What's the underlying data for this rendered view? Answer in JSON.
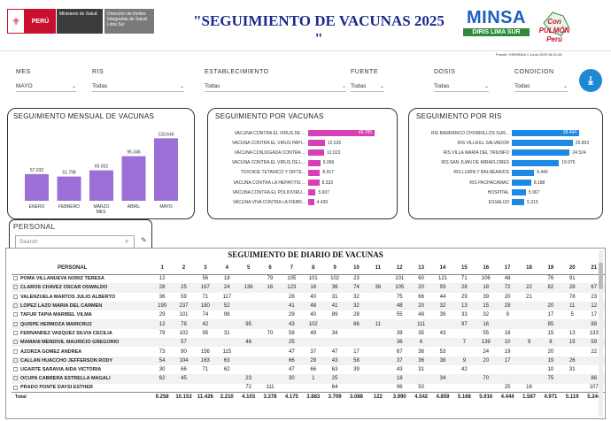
{
  "header": {
    "peru_label": "PERÚ",
    "ministerio": "Ministerio de Salud",
    "diris": "Dirección de Redes Integradas de Salud Lima Sur",
    "title": "\"SEGUIMIENTO DE VACUNAS 2025 \"",
    "minsa": "MINSA",
    "diris_lima_sur": "DIRIS LIMA SUR",
    "con_pulmon": "Con PULMÓN Perú",
    "fuente": "Fuente: HISMINSA 1 Junio 2025 18:21:48"
  },
  "filters": [
    {
      "label": "MES",
      "value": "MAYO"
    },
    {
      "label": "RIS",
      "value": "Todas"
    },
    {
      "label": "ESTABLECIMIENTO",
      "value": "Todas"
    },
    {
      "label": "FUENTE",
      "value": "Todas"
    },
    {
      "label": "DOSIS",
      "value": "Todas"
    },
    {
      "label": "CONDICION",
      "value": "Todas"
    }
  ],
  "colors": {
    "purple": "#9b6fd6",
    "pink": "#d63fb5",
    "blue": "#1e88e5"
  },
  "monthly": {
    "title": "SEGUIMIENTO MENSUAL DE VACUNAS",
    "xlabel": "MES",
    "categories": [
      "ENERO",
      "FEBRERO",
      "MARZO",
      "ABRIL",
      "MAYO"
    ],
    "values": [
      57032,
      51798,
      65052,
      95346,
      133646
    ],
    "labels": [
      "57.032",
      "51.798",
      "65.052",
      "95.346",
      "133.646"
    ]
  },
  "vacunas": {
    "title": "SEGUIMIENTO POR VACUNAS",
    "items": [
      {
        "label": "VACUNA CONTRA EL VIRUS DE ...",
        "value": 49785,
        "text": "49.785"
      },
      {
        "label": "VACUNA CONTRA EL VIRUS PAPI...",
        "value": 12526,
        "text": "12.526"
      },
      {
        "label": "VACUNA CONJUGADA CONTRA ...",
        "value": 12023,
        "text": "12.023"
      },
      {
        "label": "VACUNA CONTRA EL VIRUS DE L...",
        "value": 9068,
        "text": "9.068"
      },
      {
        "label": "TOXOIDE TETANICO Y DIFTÉ...",
        "value": 8917,
        "text": "8.917"
      },
      {
        "label": "VACUNA CONTRA LA HEPATITIS ...",
        "value": 8333,
        "text": "8.333"
      },
      {
        "label": "VACUNA CONTRA EL POLIOVIRU...",
        "value": 5607,
        "text": "5.607"
      },
      {
        "label": "VACUNA VIVA CONTRA LA FIEBR...",
        "value": 4439,
        "text": "4.439"
      }
    ]
  },
  "ris": {
    "title": "SEGUIMIENTO POR RIS",
    "items": [
      {
        "label": "RIS BARRANCO CHORRILLOS SUR...",
        "value": 28494,
        "text": "28.494"
      },
      {
        "label": "RIS VILLA EL SALVADOR",
        "value": 25803,
        "text": "25.803"
      },
      {
        "label": "RIS VILLA MARIA DEL TRIUNFO",
        "value": 24524,
        "text": "24.524"
      },
      {
        "label": "RIS SAN JUAN DE MIRAFLORES",
        "value": 19976,
        "text": "19.976"
      },
      {
        "label": "RIS LURIN Y BALNEARIOS",
        "value": 9440,
        "text": "9.440"
      },
      {
        "label": "RIS PACHACAMAC",
        "value": 8188,
        "text": "8.188"
      },
      {
        "label": "HOSPITAL",
        "value": 5967,
        "text": "5.967"
      },
      {
        "label": "ESSALUD",
        "value": 5315,
        "text": "5.315"
      }
    ]
  },
  "personal": {
    "label": "PERSONAL",
    "placeholder": "Search"
  },
  "table": {
    "title": "SEGUIMIENTO DE DIARIO DE VACUNAS",
    "name_header": "PERSONAL",
    "days": [
      "1",
      "2",
      "3",
      "4",
      "5",
      "6",
      "7",
      "8",
      "9",
      "10",
      "11",
      "12",
      "13",
      "14",
      "15",
      "16",
      "17",
      "18",
      "19",
      "20",
      "21"
    ],
    "rows": [
      {
        "name": "POMA VILLANUEVA NORIZ TERESA",
        "v": [
          "12",
          "",
          "56",
          "18",
          "",
          "79",
          "105",
          "101",
          "102",
          "23",
          "",
          "101",
          "60",
          "121",
          "71",
          "106",
          "48",
          "",
          "76",
          "91",
          ""
        ]
      },
      {
        "name": "CLAROS CHAVEZ OSCAR OSWALDO",
        "v": [
          "28",
          "25",
          "167",
          "24",
          "136",
          "16",
          "123",
          "18",
          "36",
          "74",
          "36",
          "105",
          "20",
          "93",
          "28",
          "18",
          "72",
          "22",
          "82",
          "28",
          "67"
        ]
      },
      {
        "name": "VALENZUELA MARTOS JULIO ALBERTO",
        "v": [
          "36",
          "59",
          "71",
          "117",
          "",
          "",
          "26",
          "40",
          "31",
          "32",
          "",
          "75",
          "66",
          "44",
          "29",
          "39",
          "20",
          "21",
          "",
          "78",
          "23"
        ]
      },
      {
        "name": "LOPEZ LAZO MARIA DEL CARMEN",
        "v": [
          "190",
          "237",
          "180",
          "52",
          "",
          "",
          "41",
          "48",
          "41",
          "32",
          "",
          "48",
          "20",
          "32",
          "13",
          "15",
          "29",
          "",
          "20",
          "11",
          "12"
        ]
      },
      {
        "name": "TAFUR TAPIA MARIBEL VILMA",
        "v": [
          "29",
          "101",
          "74",
          "98",
          "",
          "",
          "29",
          "40",
          "89",
          "28",
          "",
          "55",
          "48",
          "39",
          "33",
          "32",
          "9",
          "",
          "17",
          "5",
          "17"
        ]
      },
      {
        "name": "QUISPE HERMOZA MARICRUZ",
        "v": [
          "12",
          "78",
          "42",
          "",
          "95",
          "",
          "43",
          "102",
          "",
          "86",
          "11",
          "",
          "111",
          "",
          "97",
          "16",
          "",
          "",
          "85",
          "",
          "88"
        ]
      },
      {
        "name": "FERNANDEZ VASQUEZ SILVIA CECILIA",
        "v": [
          "79",
          "102",
          "95",
          "31",
          "",
          "70",
          "58",
          "49",
          "34",
          "",
          "",
          "39",
          "35",
          "43",
          "",
          "55",
          "18",
          "",
          "15",
          "13",
          "133"
        ]
      },
      {
        "name": "MAMANI MENDIVIL MAURICIO GREGORIO",
        "v": [
          "",
          "57",
          "",
          "",
          "46",
          "",
          "25",
          "",
          "",
          "",
          "",
          "36",
          "6",
          "",
          "7",
          "139",
          "10",
          "9",
          "8",
          "15",
          "59"
        ]
      },
      {
        "name": "AZORZA GOMEZ ANDREA",
        "v": [
          "73",
          "90",
          "156",
          "115",
          "",
          "",
          "47",
          "37",
          "47",
          "17",
          "",
          "67",
          "36",
          "53",
          "",
          "24",
          "19",
          "",
          "20",
          "",
          "22"
        ]
      },
      {
        "name": "CALLAN HUACCHO JEFFERSON RODY",
        "v": [
          "54",
          "104",
          "163",
          "63",
          "",
          "",
          "66",
          "29",
          "43",
          "58",
          "",
          "37",
          "36",
          "38",
          "9",
          "20",
          "17",
          "",
          "19",
          "26",
          ""
        ]
      },
      {
        "name": "UGARTE SARAVIA AIDA VICTORIA",
        "v": [
          "30",
          "66",
          "71",
          "62",
          "",
          "",
          "47",
          "66",
          "63",
          "39",
          "",
          "43",
          "31",
          "",
          "42",
          "",
          "",
          "",
          "10",
          "31",
          ""
        ]
      },
      {
        "name": "OCUPA CABRERA ESTRELLA MAGALI",
        "v": [
          "62",
          "45",
          "",
          "",
          "23",
          "",
          "30",
          "1",
          "25",
          "",
          "",
          "18",
          "",
          "34",
          "",
          "70",
          "",
          "",
          "75",
          "",
          "86"
        ]
      },
      {
        "name": "PRADO PONTE DAYSI ESTHER",
        "v": [
          "",
          "",
          "",
          "",
          "72",
          "111",
          "",
          "",
          "64",
          "",
          "",
          "96",
          "50",
          "",
          "",
          "",
          "25",
          "16",
          "",
          "",
          "107"
        ]
      }
    ],
    "total": {
      "name": "Total",
      "v": [
        "9.258",
        "10.153",
        "11.426",
        "2.210",
        "4.103",
        "3.378",
        "4.175",
        "3.883",
        "3.709",
        "3.088",
        "122",
        "3.990",
        "4.542",
        "4.859",
        "5.168",
        "5.916",
        "4.444",
        "1.587",
        "4.971",
        "5.119",
        "5.244"
      ]
    }
  }
}
